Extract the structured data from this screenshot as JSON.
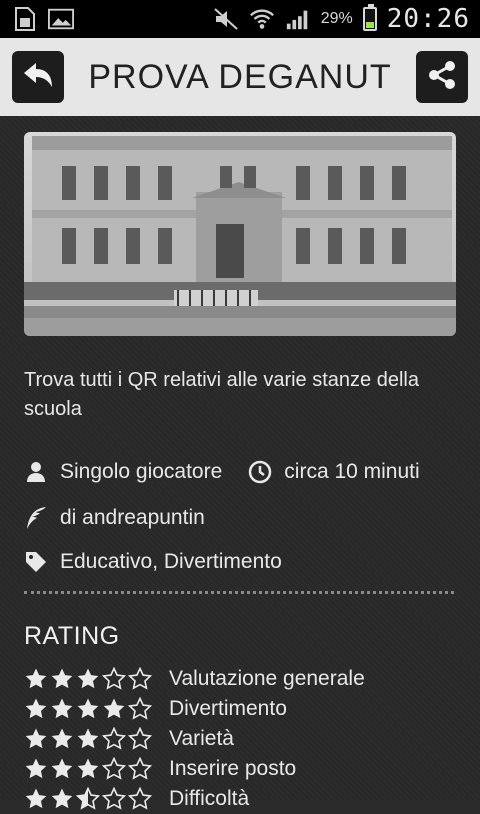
{
  "status_bar": {
    "battery_percent": "29%",
    "battery_level": 0.29,
    "time": "20:26",
    "icons": [
      "sim-card-icon",
      "gallery-icon",
      "mute-icon",
      "wifi-icon",
      "signal-icon",
      "battery-icon"
    ]
  },
  "header": {
    "title": "PROVA DEGANUT",
    "back_icon": "back-arrow-icon",
    "share_icon": "share-icon"
  },
  "detail": {
    "description": "Trova tutti i QR relativi alle varie stanze della scuola",
    "players": "Singolo giocatore",
    "duration": "circa 10 minuti",
    "author": "di andreapuntin",
    "tags": "Educativo, Divertimento"
  },
  "rating": {
    "title": "RATING",
    "items": [
      {
        "label": "Valutazione generale",
        "stars": 3
      },
      {
        "label": "Divertimento",
        "stars": 4
      },
      {
        "label": "Varietà",
        "stars": 3
      },
      {
        "label": "Inserire posto",
        "stars": 3
      },
      {
        "label": "Difficoltà",
        "stars": 2.5
      }
    ]
  },
  "colors": {
    "header_bg": "#e6e6e6",
    "button_bg": "#1d1d1d",
    "content_bg": "#282828",
    "battery_fill": "#9be34a"
  }
}
